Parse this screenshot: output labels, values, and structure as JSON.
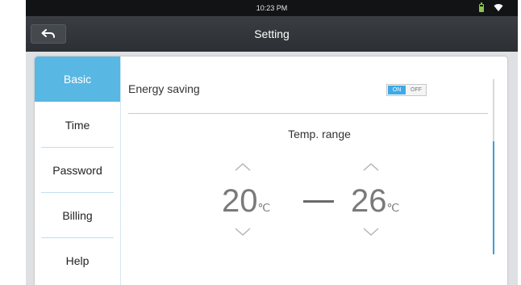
{
  "status_bar": {
    "time": "10:23 PM",
    "icons": [
      "battery-icon",
      "wifi-icon"
    ]
  },
  "header": {
    "title": "Setting",
    "back_icon": "back-arrow-icon"
  },
  "sidebar": {
    "items": [
      {
        "label": "Basic",
        "active": true
      },
      {
        "label": "Time",
        "active": false
      },
      {
        "label": "Password",
        "active": false
      },
      {
        "label": "Billing",
        "active": false
      },
      {
        "label": "Help",
        "active": false
      }
    ]
  },
  "content": {
    "energy_saving": {
      "label": "Energy saving",
      "on_label": "ON",
      "off_label": "OFF",
      "state": "ON"
    },
    "temp_range": {
      "label": "Temp. range",
      "min": "20",
      "max": "26",
      "unit": "℃"
    }
  },
  "colors": {
    "accent": "#59b7e3",
    "toggle_on": "#3fa9e6",
    "header_bg": "#2f3337",
    "status_bg": "#111315",
    "battery": "#8dc44a"
  }
}
